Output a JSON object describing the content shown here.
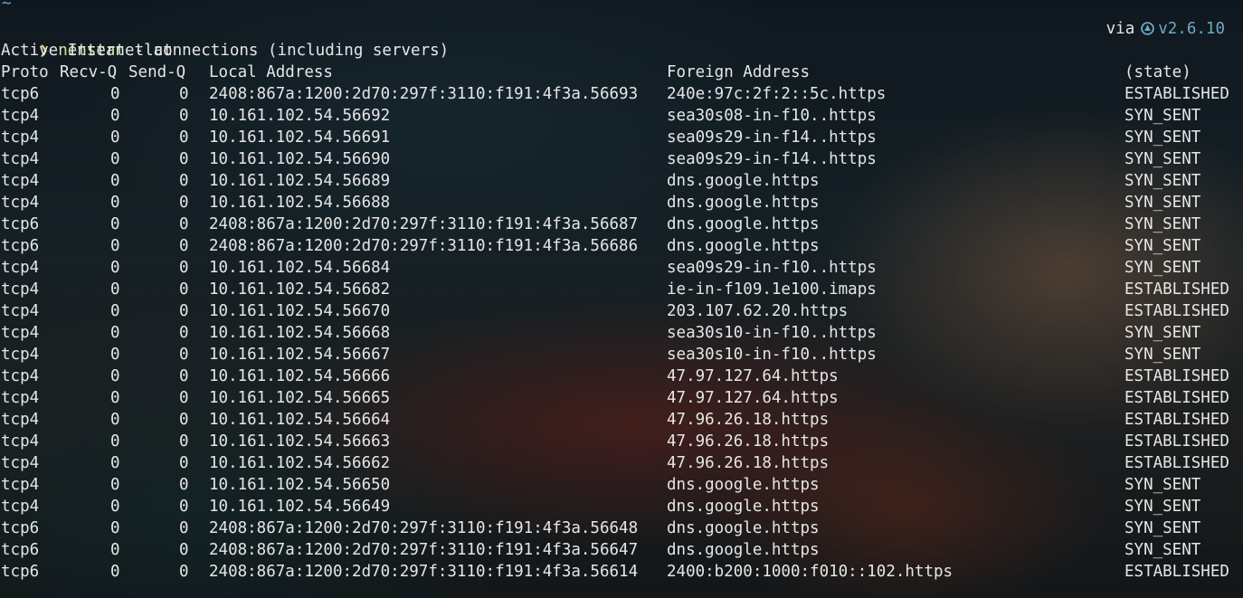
{
  "terminal": {
    "cwd_marker": "~",
    "prompt_symbol": "❯",
    "command": "netstat",
    "command_args": "-lat",
    "status_via": "via",
    "status_icon": "rust-icon",
    "status_version": "v2.6.10",
    "title_line": "Active Internet connections (including servers)",
    "headers": {
      "proto": "Proto",
      "recv": "Recv-Q",
      "send": "Send-Q",
      "local": "Local Address",
      "foreign": "Foreign Address",
      "state": "(state)"
    },
    "rows": [
      {
        "proto": "tcp6",
        "recv": "0",
        "send": "0",
        "local": "2408:867a:1200:2d70:297f:3110:f191:4f3a.56693",
        "foreign": "240e:97c:2f:2::5c.https",
        "state": "ESTABLISHED"
      },
      {
        "proto": "tcp4",
        "recv": "0",
        "send": "0",
        "local": "10.161.102.54.56692",
        "foreign": "sea30s08-in-f10..https",
        "state": "SYN_SENT"
      },
      {
        "proto": "tcp4",
        "recv": "0",
        "send": "0",
        "local": "10.161.102.54.56691",
        "foreign": "sea09s29-in-f14..https",
        "state": "SYN_SENT"
      },
      {
        "proto": "tcp4",
        "recv": "0",
        "send": "0",
        "local": "10.161.102.54.56690",
        "foreign": "sea09s29-in-f14..https",
        "state": "SYN_SENT"
      },
      {
        "proto": "tcp4",
        "recv": "0",
        "send": "0",
        "local": "10.161.102.54.56689",
        "foreign": "dns.google.https",
        "state": "SYN_SENT"
      },
      {
        "proto": "tcp4",
        "recv": "0",
        "send": "0",
        "local": "10.161.102.54.56688",
        "foreign": "dns.google.https",
        "state": "SYN_SENT"
      },
      {
        "proto": "tcp6",
        "recv": "0",
        "send": "0",
        "local": "2408:867a:1200:2d70:297f:3110:f191:4f3a.56687",
        "foreign": "dns.google.https",
        "state": "SYN_SENT"
      },
      {
        "proto": "tcp6",
        "recv": "0",
        "send": "0",
        "local": "2408:867a:1200:2d70:297f:3110:f191:4f3a.56686",
        "foreign": "dns.google.https",
        "state": "SYN_SENT"
      },
      {
        "proto": "tcp4",
        "recv": "0",
        "send": "0",
        "local": "10.161.102.54.56684",
        "foreign": "sea09s29-in-f10..https",
        "state": "SYN_SENT"
      },
      {
        "proto": "tcp4",
        "recv": "0",
        "send": "0",
        "local": "10.161.102.54.56682",
        "foreign": "ie-in-f109.1e100.imaps",
        "state": "ESTABLISHED"
      },
      {
        "proto": "tcp4",
        "recv": "0",
        "send": "0",
        "local": "10.161.102.54.56670",
        "foreign": "203.107.62.20.https",
        "state": "ESTABLISHED"
      },
      {
        "proto": "tcp4",
        "recv": "0",
        "send": "0",
        "local": "10.161.102.54.56668",
        "foreign": "sea30s10-in-f10..https",
        "state": "SYN_SENT"
      },
      {
        "proto": "tcp4",
        "recv": "0",
        "send": "0",
        "local": "10.161.102.54.56667",
        "foreign": "sea30s10-in-f10..https",
        "state": "SYN_SENT"
      },
      {
        "proto": "tcp4",
        "recv": "0",
        "send": "0",
        "local": "10.161.102.54.56666",
        "foreign": "47.97.127.64.https",
        "state": "ESTABLISHED"
      },
      {
        "proto": "tcp4",
        "recv": "0",
        "send": "0",
        "local": "10.161.102.54.56665",
        "foreign": "47.97.127.64.https",
        "state": "ESTABLISHED"
      },
      {
        "proto": "tcp4",
        "recv": "0",
        "send": "0",
        "local": "10.161.102.54.56664",
        "foreign": "47.96.26.18.https",
        "state": "ESTABLISHED"
      },
      {
        "proto": "tcp4",
        "recv": "0",
        "send": "0",
        "local": "10.161.102.54.56663",
        "foreign": "47.96.26.18.https",
        "state": "ESTABLISHED"
      },
      {
        "proto": "tcp4",
        "recv": "0",
        "send": "0",
        "local": "10.161.102.54.56662",
        "foreign": "47.96.26.18.https",
        "state": "ESTABLISHED"
      },
      {
        "proto": "tcp4",
        "recv": "0",
        "send": "0",
        "local": "10.161.102.54.56650",
        "foreign": "dns.google.https",
        "state": "SYN_SENT"
      },
      {
        "proto": "tcp4",
        "recv": "0",
        "send": "0",
        "local": "10.161.102.54.56649",
        "foreign": "dns.google.https",
        "state": "SYN_SENT"
      },
      {
        "proto": "tcp6",
        "recv": "0",
        "send": "0",
        "local": "2408:867a:1200:2d70:297f:3110:f191:4f3a.56648",
        "foreign": "dns.google.https",
        "state": "SYN_SENT"
      },
      {
        "proto": "tcp6",
        "recv": "0",
        "send": "0",
        "local": "2408:867a:1200:2d70:297f:3110:f191:4f3a.56647",
        "foreign": "dns.google.https",
        "state": "SYN_SENT"
      },
      {
        "proto": "tcp6",
        "recv": "0",
        "send": "0",
        "local": "2408:867a:1200:2d70:297f:3110:f191:4f3a.56614",
        "foreign": "2400:b200:1000:f010::102.https",
        "state": "ESTABLISHED"
      }
    ]
  },
  "colors": {
    "prompt": "#e6d36a",
    "command": "#cfe7a8",
    "version": "#6fa8c8",
    "text": "#e6e6e6"
  }
}
